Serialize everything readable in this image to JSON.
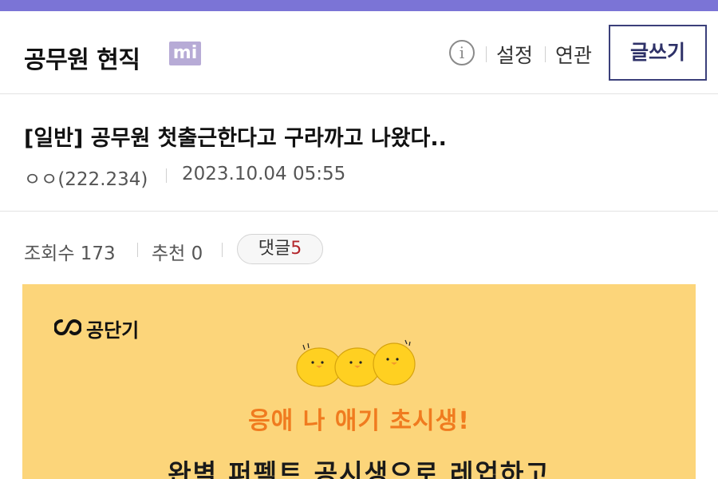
{
  "gallery": {
    "title": "공무원 현직",
    "badge": "mi",
    "info_icon": "i",
    "links": [
      "설정",
      "연관"
    ],
    "write_label": "글쓰기"
  },
  "post": {
    "title": "[일반] 공무원 첫출근한다고 구라까고 나왔다..",
    "author": "ㅇㅇ(222.234)",
    "date": "2023.10.04 05:55"
  },
  "stats": {
    "views": "조회수 173",
    "recommend": "추천 0",
    "comments_label": "댓글",
    "comments_count": "5"
  },
  "ad": {
    "brand": "공단기",
    "headline": "응애 나 애기 초시생!",
    "subline": "완벽 퍼펙트 공시생으로 레업하고"
  },
  "colors": {
    "accent_bar": "#7b74d6",
    "badge": "#b7abd6",
    "write_button": "#2e3168",
    "comment_count": "#b3262b",
    "ad_background": "#fcd57a",
    "ad_headline": "#f07b1f"
  }
}
